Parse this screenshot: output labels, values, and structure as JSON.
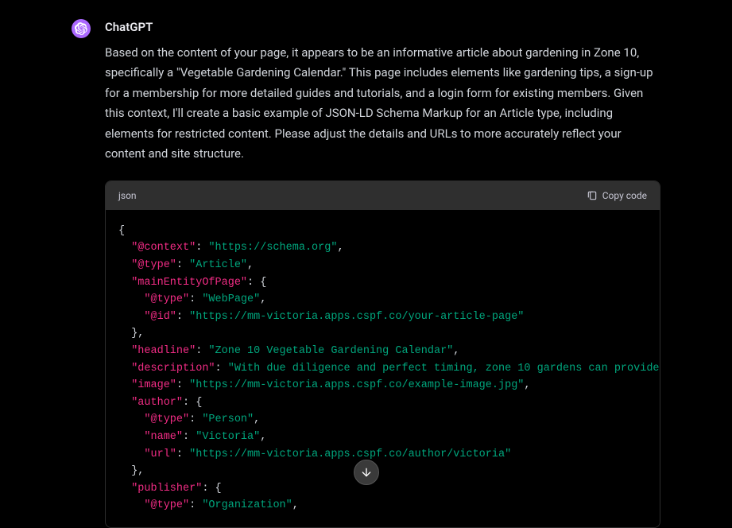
{
  "message": {
    "sender": "ChatGPT",
    "body": "Based on the content of your page, it appears to be an informative article about gardening in Zone 10, specifically a \"Vegetable Gardening Calendar.\" This page includes elements like gardening tips, a sign-up for a membership for more detailed guides and tutorials, and a login form for existing members. Given this context, I'll create a basic example of JSON-LD Schema Markup for an Article type, including elements for restricted content. Please adjust the details and URLs to more accurately reflect your content and site structure."
  },
  "code": {
    "language": "json",
    "copy_label": "Copy code",
    "lines": [
      [
        [
          "punc",
          "{"
        ]
      ],
      [
        [
          "indent",
          1
        ],
        [
          "key",
          "\"@context\""
        ],
        [
          "punc",
          ": "
        ],
        [
          "str",
          "\"https://schema.org\""
        ],
        [
          "punc",
          ","
        ]
      ],
      [
        [
          "indent",
          1
        ],
        [
          "key",
          "\"@type\""
        ],
        [
          "punc",
          ": "
        ],
        [
          "str",
          "\"Article\""
        ],
        [
          "punc",
          ","
        ]
      ],
      [
        [
          "indent",
          1
        ],
        [
          "key",
          "\"mainEntityOfPage\""
        ],
        [
          "punc",
          ": {"
        ]
      ],
      [
        [
          "indent",
          2
        ],
        [
          "key",
          "\"@type\""
        ],
        [
          "punc",
          ": "
        ],
        [
          "str",
          "\"WebPage\""
        ],
        [
          "punc",
          ","
        ]
      ],
      [
        [
          "indent",
          2
        ],
        [
          "key",
          "\"@id\""
        ],
        [
          "punc",
          ": "
        ],
        [
          "str",
          "\"https://mm-victoria.apps.cspf.co/your-article-page\""
        ]
      ],
      [
        [
          "indent",
          1
        ],
        [
          "punc",
          "},"
        ]
      ],
      [
        [
          "indent",
          1
        ],
        [
          "key",
          "\"headline\""
        ],
        [
          "punc",
          ": "
        ],
        [
          "str",
          "\"Zone 10 Vegetable Gardening Calendar\""
        ],
        [
          "punc",
          ","
        ]
      ],
      [
        [
          "indent",
          1
        ],
        [
          "key",
          "\"description\""
        ],
        [
          "punc",
          ": "
        ],
        [
          "str",
          "\"With due diligence and perfect timing, zone 10 gardens can provide"
        ]
      ],
      [
        [
          "indent",
          1
        ],
        [
          "key",
          "\"image\""
        ],
        [
          "punc",
          ": "
        ],
        [
          "str",
          "\"https://mm-victoria.apps.cspf.co/example-image.jpg\""
        ],
        [
          "punc",
          ","
        ]
      ],
      [
        [
          "indent",
          1
        ],
        [
          "key",
          "\"author\""
        ],
        [
          "punc",
          ": {"
        ]
      ],
      [
        [
          "indent",
          2
        ],
        [
          "key",
          "\"@type\""
        ],
        [
          "punc",
          ": "
        ],
        [
          "str",
          "\"Person\""
        ],
        [
          "punc",
          ","
        ]
      ],
      [
        [
          "indent",
          2
        ],
        [
          "key",
          "\"name\""
        ],
        [
          "punc",
          ": "
        ],
        [
          "str",
          "\"Victoria\""
        ],
        [
          "punc",
          ","
        ]
      ],
      [
        [
          "indent",
          2
        ],
        [
          "key",
          "\"url\""
        ],
        [
          "punc",
          ": "
        ],
        [
          "str",
          "\"https://mm-victoria.apps.cspf.co/author/victoria\""
        ]
      ],
      [
        [
          "indent",
          1
        ],
        [
          "punc",
          "},"
        ]
      ],
      [
        [
          "indent",
          1
        ],
        [
          "key",
          "\"publisher\""
        ],
        [
          "punc",
          ": {"
        ]
      ],
      [
        [
          "indent",
          2
        ],
        [
          "key",
          "\"@type\""
        ],
        [
          "punc",
          ": "
        ],
        [
          "str",
          "\"Organization\""
        ],
        [
          "punc",
          ","
        ]
      ]
    ]
  }
}
